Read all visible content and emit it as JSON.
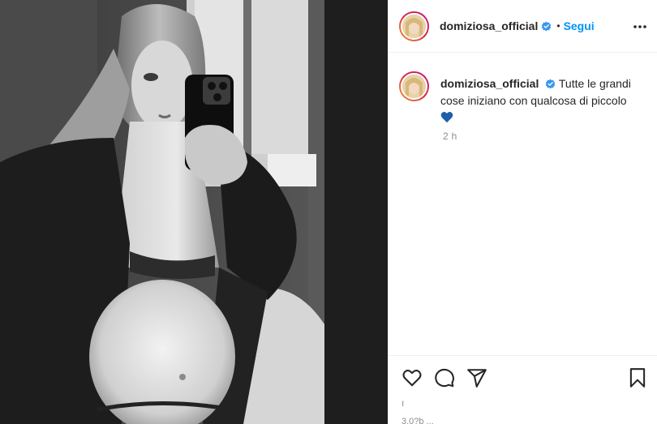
{
  "post": {
    "username": "domiziosa_official",
    "verified": true,
    "follow_label": "Segui",
    "separator": "•",
    "caption": "Tutte le grandi cose iniziano con qualcosa di piccolo",
    "caption_emoji": "blue-heart-icon",
    "timestamp": "2 h",
    "likes_placeholder": "ı",
    "views_partial": "3.0?b ..."
  },
  "icons": {
    "more": "more-options-icon",
    "like": "heart-outline-icon",
    "comment": "comment-icon",
    "share": "direct-share-icon",
    "save": "bookmark-icon",
    "verified": "verified-badge-icon"
  },
  "colors": {
    "accent": "#0095f6",
    "verified": "#3897f0",
    "blue_heart": "#1f5fa8"
  }
}
